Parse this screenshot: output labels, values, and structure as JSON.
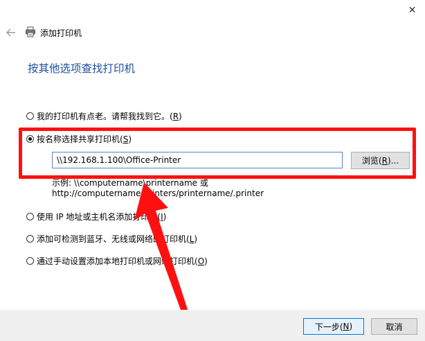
{
  "window": {
    "title": "添加打印机",
    "close_glyph": "✕"
  },
  "page": {
    "heading": "按其他选项查找打印机"
  },
  "options": [
    {
      "label_pre": "我的打印机有点老。请帮我找到它。(",
      "key": "R",
      "label_post": ")",
      "selected": false
    },
    {
      "label_pre": "按名称选择共享打印机(",
      "key": "S",
      "label_post": ")",
      "selected": true
    },
    {
      "label_pre": "使用 IP 地址或主机名添加打印机(",
      "key": "I",
      "label_post": ")",
      "selected": false
    },
    {
      "label_pre": "添加可检测到蓝牙、无线或网络的打印机(",
      "key": "L",
      "label_post": ")",
      "selected": false
    },
    {
      "label_pre": "通过手动设置添加本地打印机或网络打印机(",
      "key": "O",
      "label_post": ")",
      "selected": false
    }
  ],
  "shared_printer": {
    "value": "\\\\192.168.1.100\\Office-Printer",
    "browse_pre": "浏览(",
    "browse_key": "R",
    "browse_post": ")...",
    "example_line1": "示例: \\\\computername\\printername 或",
    "example_line2": "http://computername/printers/printername/.printer"
  },
  "footer": {
    "next_pre": "下一步(",
    "next_key": "N",
    "next_post": ")",
    "cancel_label": "取消"
  },
  "icons": {
    "back": "back-arrow-icon",
    "printer": "printer-icon",
    "close": "close-icon"
  },
  "colors": {
    "heading": "#1d4fa3",
    "annotation": "#ff1010",
    "focus_border": "#0078d7"
  }
}
